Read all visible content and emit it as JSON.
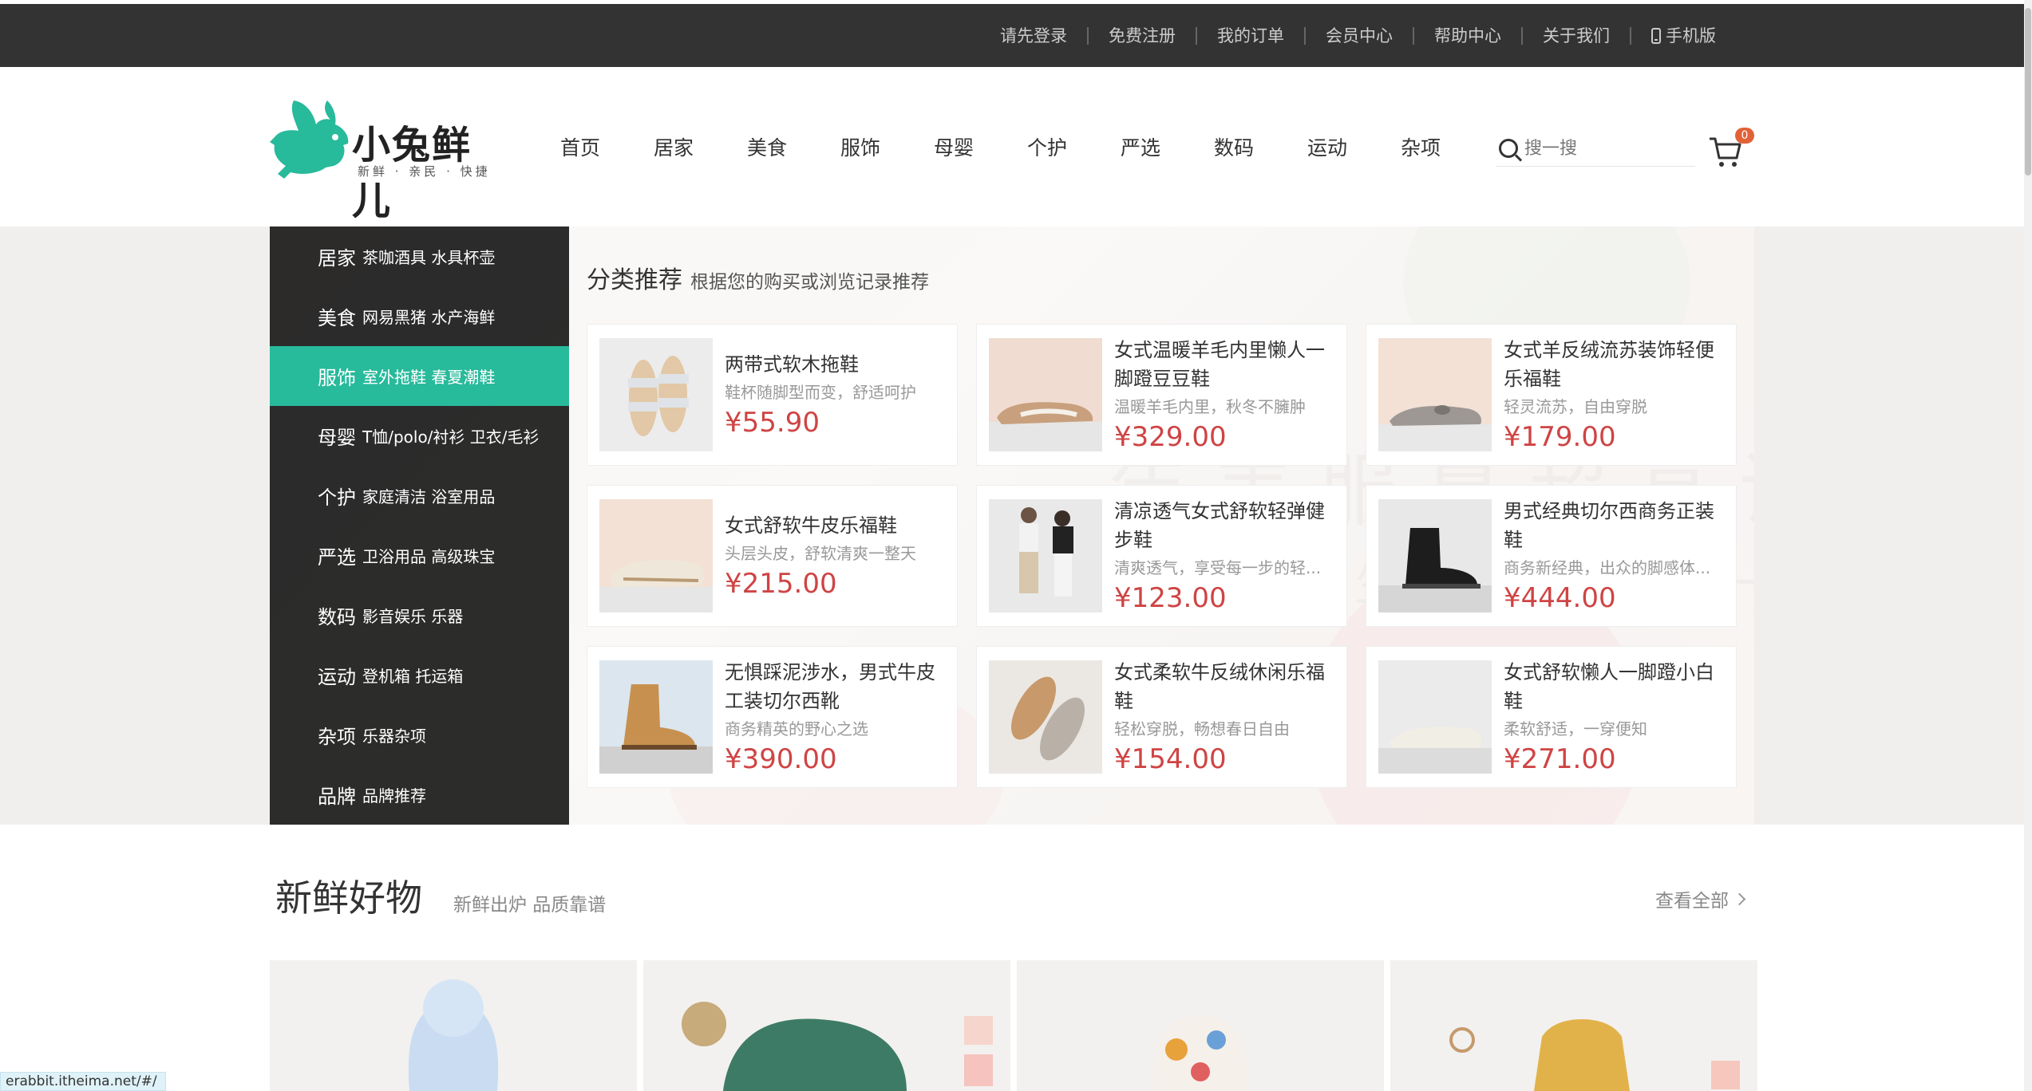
{
  "topnav": [
    {
      "label": "请先登录"
    },
    {
      "label": "免费注册"
    },
    {
      "label": "我的订单"
    },
    {
      "label": "会员中心"
    },
    {
      "label": "帮助中心"
    },
    {
      "label": "关于我们"
    },
    {
      "label": "手机版",
      "icon": "phone-icon"
    }
  ],
  "logo": {
    "title": "小兔鲜儿",
    "subtitle": "新鲜 · 亲民 · 快捷",
    "color": "#27ba9b"
  },
  "mainnav": [
    "首页",
    "居家",
    "美食",
    "服饰",
    "母婴",
    "个护",
    "严选",
    "数码",
    "运动",
    "杂项"
  ],
  "search": {
    "placeholder": "搜一搜"
  },
  "cart": {
    "count": "0"
  },
  "categories": [
    {
      "name": "居家",
      "sub": "茶咖酒具 水具杯壶"
    },
    {
      "name": "美食",
      "sub": "网易黑猪 水产海鲜"
    },
    {
      "name": "服饰",
      "sub": "室外拖鞋 春夏潮鞋",
      "active": true
    },
    {
      "name": "母婴",
      "sub": "T恤/polo/衬衫 卫衣/毛衫"
    },
    {
      "name": "个护",
      "sub": "家庭清洁 浴室用品"
    },
    {
      "name": "严选",
      "sub": "卫浴用品 高级珠宝"
    },
    {
      "name": "数码",
      "sub": "影音娱乐 乐器"
    },
    {
      "name": "运动",
      "sub": "登机箱 托运箱"
    },
    {
      "name": "杂项",
      "sub": "乐器杂项"
    },
    {
      "name": "品牌",
      "sub": "品牌推荐"
    }
  ],
  "recommend": {
    "title": "分类推荐",
    "subtitle": "根据您的购买或浏览记录推荐",
    "products": [
      {
        "name": "两带式软木拖鞋",
        "desc": "鞋杯随脚型而变，舒适呵护",
        "price": "¥55.90"
      },
      {
        "name": "女式温暖羊毛内里懒人一脚蹬豆豆鞋",
        "desc": "温暖羊毛内里，秋冬不臃肿",
        "price": "¥329.00"
      },
      {
        "name": "女式羊反绒流苏装饰轻便乐福鞋",
        "desc": "轻灵流苏，自由穿脱",
        "price": "¥179.00"
      },
      {
        "name": "女式舒软牛皮乐福鞋",
        "desc": "头层头皮，舒软清爽一整天",
        "price": "¥215.00"
      },
      {
        "name": "清凉透气女式舒软轻弹健步鞋",
        "desc": "清爽透气，享受每一步的轻...",
        "price": "¥123.00"
      },
      {
        "name": "男式经典切尔西商务正装鞋",
        "desc": "商务新经典，出众的脚感体...",
        "price": "¥444.00"
      },
      {
        "name": "无惧踩泥涉水，男式牛皮工装切尔西靴",
        "desc": "商务精英的野心之选",
        "price": "¥390.00"
      },
      {
        "name": "女式柔软牛反绒休闲乐福鞋",
        "desc": "轻松穿脱，畅想春日自由",
        "price": "¥154.00"
      },
      {
        "name": "女式舒软懒人一脚蹬小白鞋",
        "desc": "柔软舒适，一穿便知",
        "price": "¥271.00"
      }
    ]
  },
  "fresh": {
    "title": "新鲜好物",
    "subtitle": "新鲜出炉 品质靠谱",
    "view_all": "查看全部"
  },
  "status_url": "erabbit.itheima.net/#/"
}
